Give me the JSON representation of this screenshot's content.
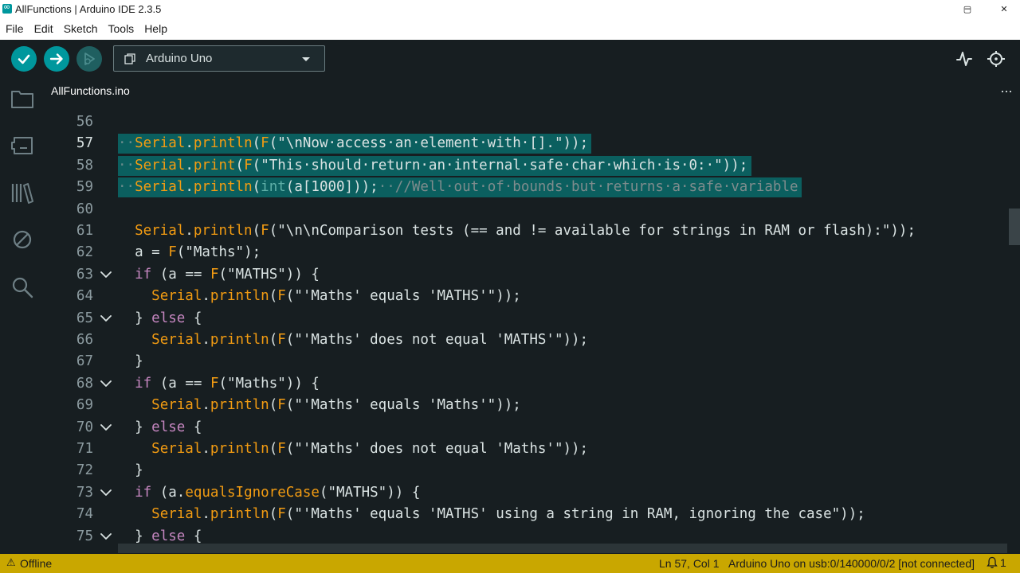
{
  "window": {
    "title": "AllFunctions | Arduino IDE 2.3.5",
    "minimize_glyph": "─",
    "maximize_glyph": "▢",
    "close_glyph": "✕"
  },
  "menu": [
    "File",
    "Edit",
    "Sketch",
    "Tools",
    "Help"
  ],
  "toolbar": {
    "board": "Arduino Uno",
    "icons": [
      "verify-icon",
      "upload-icon",
      "debug-icon",
      "serial-plotter-icon",
      "serial-monitor-icon"
    ],
    "accent": "#00979d"
  },
  "sidebar": {
    "icons": [
      "sketchbook-folder-icon",
      "boards-manager-icon",
      "library-manager-icon",
      "debug-disabled-icon",
      "search-icon"
    ]
  },
  "tabs": {
    "active": "AllFunctions.ino",
    "more": "···"
  },
  "editor": {
    "active_line": 57,
    "lines": [
      {
        "n": "56",
        "fold": false,
        "code": ""
      },
      {
        "n": "57",
        "fold": false,
        "code": "··Serial.println(F(\"\\nNow·access·an·element·with·[].\"));"
      },
      {
        "n": "58",
        "fold": false,
        "code": "··Serial.print(F(\"This·should·return·an·internal·safe·char·which·is·0:·\"));"
      },
      {
        "n": "59",
        "fold": false,
        "code": "··Serial.println(int(a[1000]));··//Well·out·of·bounds·but·returns·a·safe·variable"
      },
      {
        "n": "60",
        "fold": false,
        "code": ""
      },
      {
        "n": "61",
        "fold": false,
        "code": "  Serial.println(F(\"\\n\\nComparison tests (== and != available for strings in RAM or flash):\"));"
      },
      {
        "n": "62",
        "fold": false,
        "code": "  a = F(\"Maths\");"
      },
      {
        "n": "63",
        "fold": true,
        "code": "  if (a == F(\"MATHS\")) {"
      },
      {
        "n": "64",
        "fold": false,
        "code": "    Serial.println(F(\"'Maths' equals 'MATHS'\"));"
      },
      {
        "n": "65",
        "fold": true,
        "code": "  } else {"
      },
      {
        "n": "66",
        "fold": false,
        "code": "    Serial.println(F(\"'Maths' does not equal 'MATHS'\"));"
      },
      {
        "n": "67",
        "fold": false,
        "code": "  }"
      },
      {
        "n": "68",
        "fold": true,
        "code": "  if (a == F(\"Maths\")) {"
      },
      {
        "n": "69",
        "fold": false,
        "code": "    Serial.println(F(\"'Maths' equals 'Maths'\"));"
      },
      {
        "n": "70",
        "fold": true,
        "code": "  } else {"
      },
      {
        "n": "71",
        "fold": false,
        "code": "    Serial.println(F(\"'Maths' does not equal 'Maths'\"));"
      },
      {
        "n": "72",
        "fold": false,
        "code": "  }"
      },
      {
        "n": "73",
        "fold": true,
        "code": "  if (a.equalsIgnoreCase(\"MATHS\")) {"
      },
      {
        "n": "74",
        "fold": false,
        "code": "    Serial.println(F(\"'Maths' equals 'MATHS' using a string in RAM, ignoring the case\"));"
      },
      {
        "n": "75",
        "fold": true,
        "code": "  } else {"
      }
    ]
  },
  "status": {
    "warning_icon": "⚠",
    "offline": "Offline",
    "position": "Ln 57, Col 1",
    "board_port": "Arduino Uno on usb:0/140000/0/2 [not connected]",
    "notification_count": "1",
    "bar_color": "#c9a700"
  }
}
